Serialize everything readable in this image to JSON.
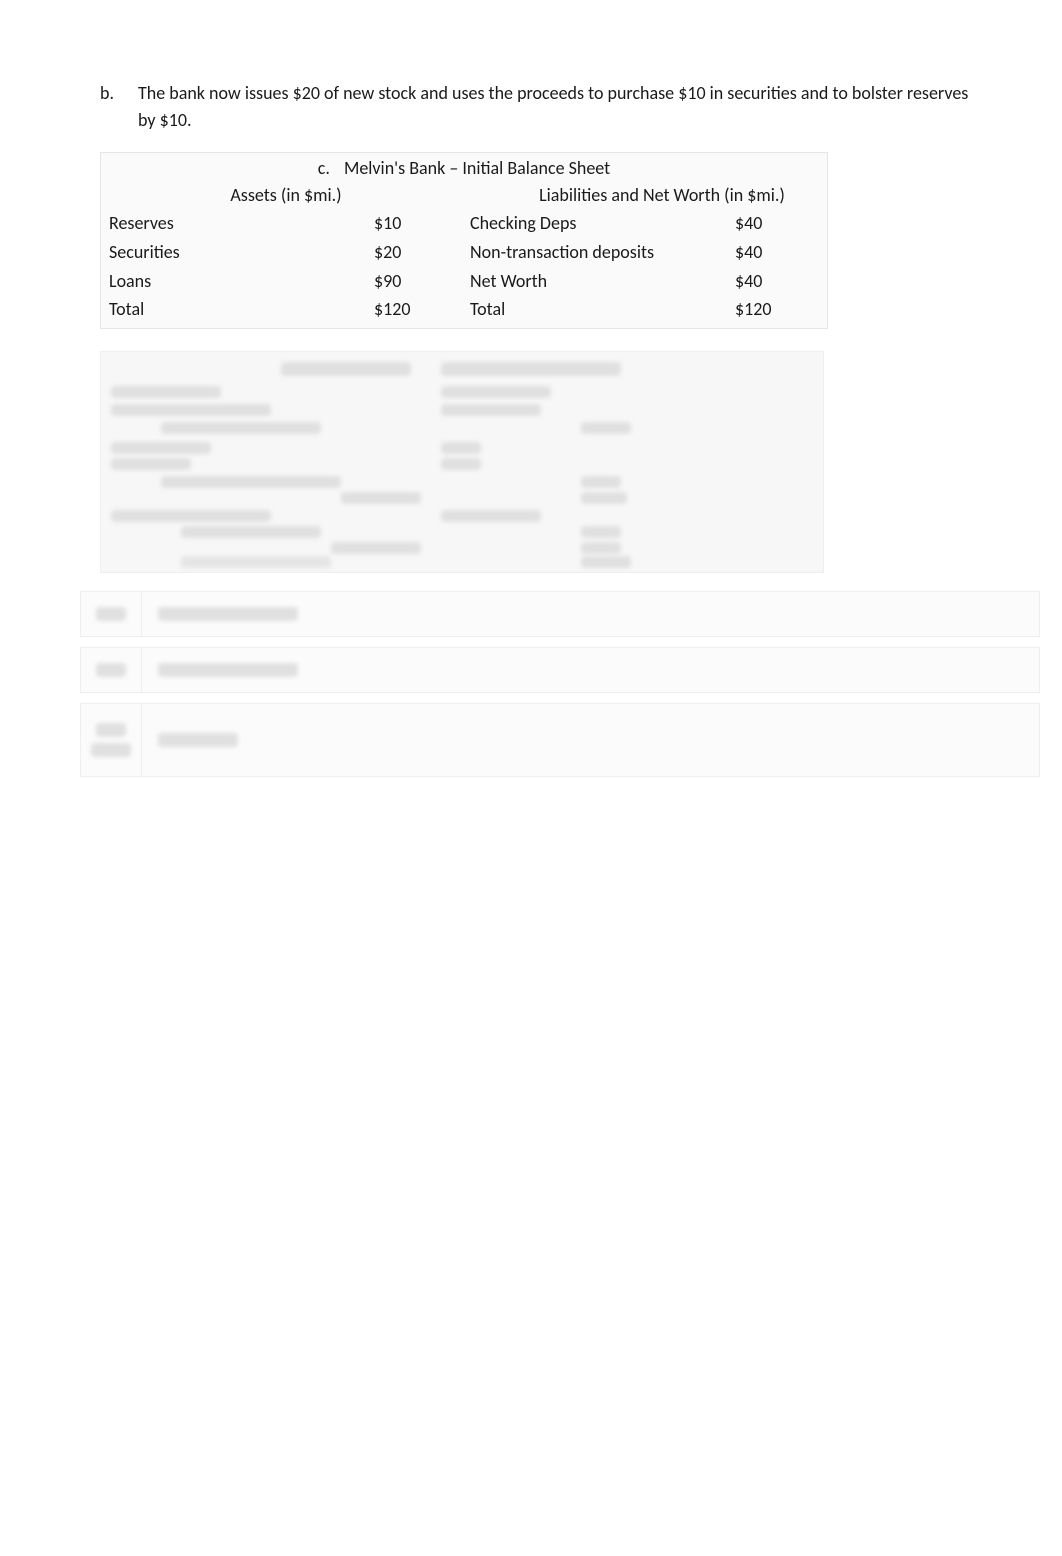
{
  "problem": {
    "bullet": "b.",
    "text": "The bank now issues $20 of new stock and uses the proceeds to purchase $10 in securities and to bolster reserves by $10."
  },
  "balance_sheet": {
    "letter": "c.",
    "title": "Melvin's Bank – Initial Balance Sheet",
    "assets_header": "Assets (in $mi.)",
    "liab_header": "Liabilities and Net Worth (in $mi.)",
    "assets": [
      {
        "label": "Reserves",
        "value": "$10"
      },
      {
        "label": "Securities",
        "value": "$20"
      },
      {
        "label": "Loans",
        "value": "$90"
      },
      {
        "label": "Total",
        "value": "$120"
      }
    ],
    "liabilities": [
      {
        "label": "Checking Deps",
        "value": "$40"
      },
      {
        "label": "Non-transaction deposits",
        "value": "$40"
      },
      {
        "label": "Net Worth",
        "value": "$40"
      },
      {
        "label": "Total",
        "value": "$120"
      }
    ]
  },
  "chart_data": {
    "type": "table",
    "title": "Melvin's Bank – Initial Balance Sheet",
    "columns": [
      "Assets (in $mi.)",
      "",
      "Liabilities and Net Worth (in $mi.)",
      ""
    ],
    "rows": [
      [
        "Reserves",
        "$10",
        "Checking Deps",
        "$40"
      ],
      [
        "Securities",
        "$20",
        "Non-transaction deposits",
        "$40"
      ],
      [
        "Loans",
        "$90",
        "Net Worth",
        "$40"
      ],
      [
        "Total",
        "$120",
        "Total",
        "$120"
      ]
    ]
  }
}
